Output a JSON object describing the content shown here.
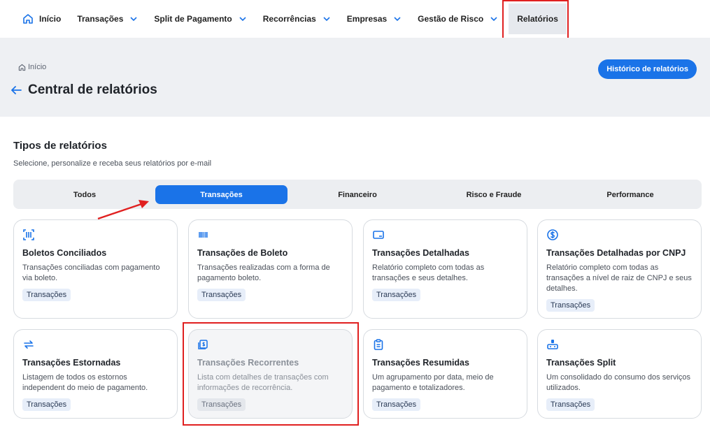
{
  "nav": {
    "home": "Início",
    "items": [
      {
        "label": "Transações",
        "dropdown": true
      },
      {
        "label": "Split de Pagamento",
        "dropdown": true
      },
      {
        "label": "Recorrências",
        "dropdown": true
      },
      {
        "label": "Empresas",
        "dropdown": true
      },
      {
        "label": "Gestão de Risco",
        "dropdown": true
      }
    ],
    "active": "Relatórios"
  },
  "header": {
    "breadcrumb": "Início",
    "title": "Central de relatórios",
    "history_button": "Histórico de relatórios"
  },
  "section": {
    "title": "Tipos de relatórios",
    "subtitle": "Selecione, personalize e receba seus relatórios por e-mail"
  },
  "tabs": [
    "Todos",
    "Transações",
    "Financeiro",
    "Risco e Fraude",
    "Performance"
  ],
  "active_tab": "Transações",
  "cards": [
    {
      "icon": "barcode-scan-icon",
      "title": "Boletos Conciliados",
      "desc": "Transações conciliadas com pagamento via boleto.",
      "tag": "Transações"
    },
    {
      "icon": "barcode-icon",
      "title": "Transações de Boleto",
      "desc": "Transações realizadas com a forma de pagamento boleto.",
      "tag": "Transações"
    },
    {
      "icon": "card-icon",
      "title": "Transações Detalhadas",
      "desc": "Relatório completo com todas as transações e seus detalhes.",
      "tag": "Transações"
    },
    {
      "icon": "dollar-circle-icon",
      "title": "Transações Detalhadas por CNPJ",
      "desc": "Relatório completo com todas as transações a nível de raiz de CNPJ e seus detalhes.",
      "tag": "Transações"
    },
    {
      "icon": "refund-arrows-icon",
      "title": "Transações Estornadas",
      "desc": "Listagem de todos os estornos independent do meio de pagamento.",
      "tag": "Transações"
    },
    {
      "icon": "recurring-money-icon",
      "title": "Transações Recorrentes",
      "desc": "Lista com detalhes de transações com informações de recorrência.",
      "tag": "Transações"
    },
    {
      "icon": "clipboard-icon",
      "title": "Transações Resumidas",
      "desc": "Um agrupamento por data, meio de pagamento e totalizadores.",
      "tag": "Transações"
    },
    {
      "icon": "split-icon",
      "title": "Transações Split",
      "desc": "Um consolidado do consumo dos serviços utilizados.",
      "tag": "Transações"
    }
  ],
  "colors": {
    "accent": "#1a73e8",
    "highlight": "#e02020",
    "band": "#eef0f3"
  }
}
